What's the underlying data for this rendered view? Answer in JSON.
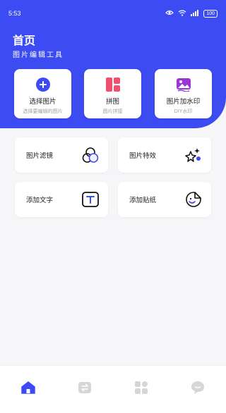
{
  "status_bar": {
    "time": "5:53",
    "battery": "100"
  },
  "header": {
    "title": "首页",
    "subtitle": "图片编辑工具"
  },
  "quick_actions": [
    {
      "label": "选择图片",
      "sub": "选择要编辑的图片",
      "icon": "plus-circle-icon"
    },
    {
      "label": "拼图",
      "sub": "图片拼接",
      "icon": "collage-grid-icon"
    },
    {
      "label": "图片加水印",
      "sub": "DIY水印",
      "icon": "image-watermark-icon"
    }
  ],
  "features": [
    {
      "label": "图片滤镜",
      "icon": "filter-circles-icon"
    },
    {
      "label": "图片特效",
      "icon": "sparkle-effects-icon"
    },
    {
      "label": "添加文字",
      "icon": "text-box-icon"
    },
    {
      "label": "添加贴纸",
      "icon": "sticker-icon"
    }
  ],
  "tabbar": [
    {
      "icon": "home-icon",
      "active": true
    },
    {
      "icon": "swap-icon",
      "active": false
    },
    {
      "icon": "apps-grid-icon",
      "active": false
    },
    {
      "icon": "chat-bubble-icon",
      "active": false
    }
  ],
  "colors": {
    "accent": "#3d4cf2",
    "hero_bg": "#3d4cf2",
    "page_bg": "#f6f6f8",
    "inactive_icon": "#d6d6d8",
    "collage_icon": "#f0506e",
    "watermark_icon": "#9a36d8"
  }
}
